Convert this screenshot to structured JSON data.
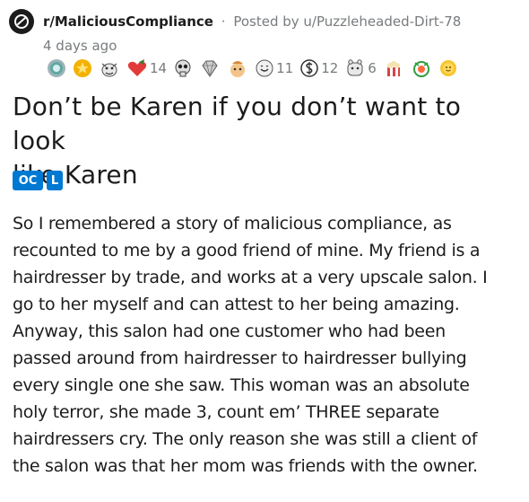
{
  "header": {
    "subreddit": "r/MaliciousCompliance",
    "separator": "·",
    "posted_by_prefix": "Posted by",
    "username": "u/Puzzleheaded-Dirt-78",
    "time_ago": "4 days ago"
  },
  "awards": [
    {
      "icon": "silver-award-icon",
      "count": ""
    },
    {
      "icon": "gold-award-icon",
      "count": ""
    },
    {
      "icon": "helpful-award-icon",
      "count": ""
    },
    {
      "icon": "heart-award-icon",
      "count": "14"
    },
    {
      "icon": "skull-award-icon",
      "count": ""
    },
    {
      "icon": "gem-award-icon",
      "count": ""
    },
    {
      "icon": "mind-blown-award-icon",
      "count": ""
    },
    {
      "icon": "wholesome-award-icon",
      "count": "11"
    },
    {
      "icon": "dollar-award-icon",
      "count": "12"
    },
    {
      "icon": "hug-award-icon",
      "count": "6"
    },
    {
      "icon": "popcorn-award-icon",
      "count": ""
    },
    {
      "icon": "bravo-award-icon",
      "count": ""
    },
    {
      "icon": "sun-award-icon",
      "count": ""
    }
  ],
  "post": {
    "title_line1": "Don’t be Karen if you don’t want to look",
    "title_line2": "like Karen",
    "flairs": [
      "OC",
      "L"
    ],
    "body_lines": [
      "So I remembered a story of malicious compliance, as",
      "recounted to me by a good friend of mine. My friend is a",
      "hairdresser by trade, and works at a very upscale salon. I",
      "go to her myself and can attest to her being amazing.",
      "Anyway, this salon had one customer who had been",
      "passed around from hairdresser to hairdresser bullying",
      "every single one she saw. This woman was an absolute",
      "holy terror, she made 3, count em’ THREE separate",
      "hairdressers cry. The only reason she was still a client of",
      "the salon was that her mom was friends with the owner."
    ]
  },
  "colors": {
    "flair_bg": "#0079d3",
    "meta_gray": "#787c7e",
    "text": "#1c1c1c"
  }
}
